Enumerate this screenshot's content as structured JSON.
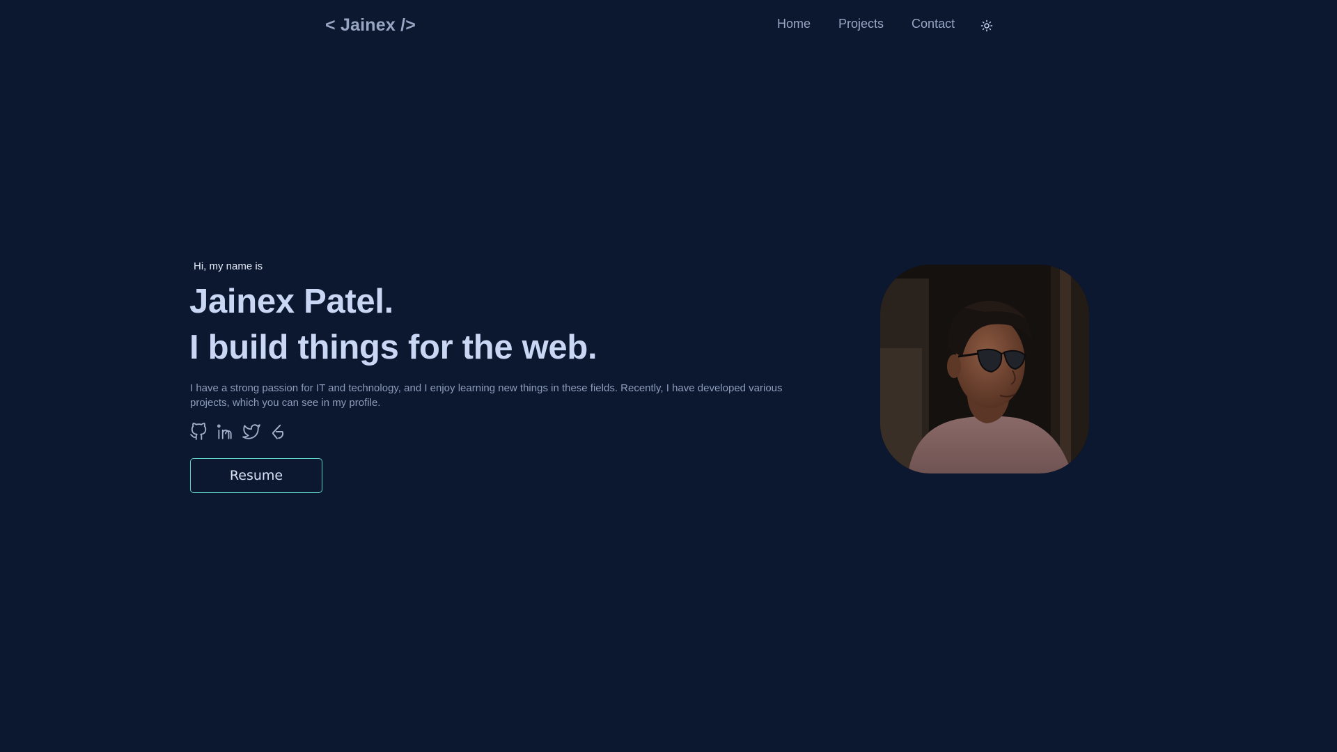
{
  "header": {
    "logo": "< Jainex />",
    "nav": [
      "Home",
      "Projects",
      "Contact"
    ],
    "theme_icon": "sun-icon"
  },
  "hero": {
    "greeting": "Hi, my name is",
    "name": "Jainex Patel.",
    "tagline": "I build things for the web.",
    "description": "I have a strong passion for IT and technology, and I enjoy learning new things in these fields. Recently, I have developed various projects, which you can see in my profile.",
    "socials": [
      "github-icon",
      "linkedin-icon",
      "twitter-icon",
      "codechef-icon"
    ],
    "resume_label": "Resume",
    "photo": "profile-photo"
  },
  "colors": {
    "background": "#0b1830",
    "heading": "#c9d6f4",
    "muted": "#8e9cbb",
    "accent": "#5fd4c8"
  }
}
